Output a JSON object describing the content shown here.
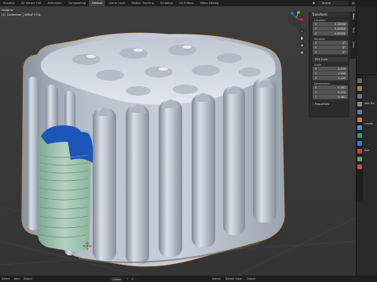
{
  "workspace_tabs": [
    "Shading",
    "3D Viewer Full",
    "Animation",
    "Compositing",
    "Default",
    "Game Logic",
    "Motion Tracking",
    "Scripting",
    "UV Editing",
    "Video Editing"
  ],
  "active_tab": "Default",
  "scene": {
    "name": "Scene"
  },
  "viewport": {
    "overlay_line1": "Graphic",
    "overlay_line2": "(1) Collection | WRAP FOIL"
  },
  "npanel": {
    "header": "Transform",
    "location_label": "Location",
    "location": [
      {
        "axis": "X",
        "value": "0.14598"
      },
      {
        "axis": "Y",
        "value": "0.00000"
      },
      {
        "axis": "Z",
        "value": "0.00000"
      }
    ],
    "rotation_label": "Rotation",
    "rotation": [
      {
        "axis": "X",
        "value": "0°"
      },
      {
        "axis": "Y",
        "value": "0°"
      },
      {
        "axis": "Z",
        "value": "0°"
      }
    ],
    "rotation_mode": "XYZ Euler",
    "scale_label": "Scale",
    "scale": [
      {
        "axis": "X",
        "value": "1.145"
      },
      {
        "axis": "Y",
        "value": "1.145"
      },
      {
        "axis": "Z",
        "value": "1.145"
      }
    ],
    "dimensions_label": "Dimensions",
    "dimensions": [
      {
        "axis": "X",
        "value": "0.387"
      },
      {
        "axis": "Y",
        "value": "0.250"
      },
      {
        "axis": "Z",
        "value": "0.381"
      }
    ],
    "properties_label": "Properties"
  },
  "sidebar_tabs": [
    "Item",
    "Tool",
    "View"
  ],
  "properties_editor": {
    "mod_label": "Add Mo",
    "subdiv_label": "Levels",
    "render_label": "Ren"
  },
  "statusbar": {
    "left": [
      "Select",
      "Add",
      "Object"
    ],
    "view_mode": "Global",
    "tools": [
      "Select",
      "Rotate View",
      "Object"
    ]
  },
  "colors": {
    "foil": "#c5ccd6",
    "foil_shadow": "#7c8592",
    "selection_outline": "#e59b2a",
    "bottle_green": "#a8c9b3",
    "cap_blue": "#1d56b8",
    "viewport_bg": "#3a3a3a"
  }
}
